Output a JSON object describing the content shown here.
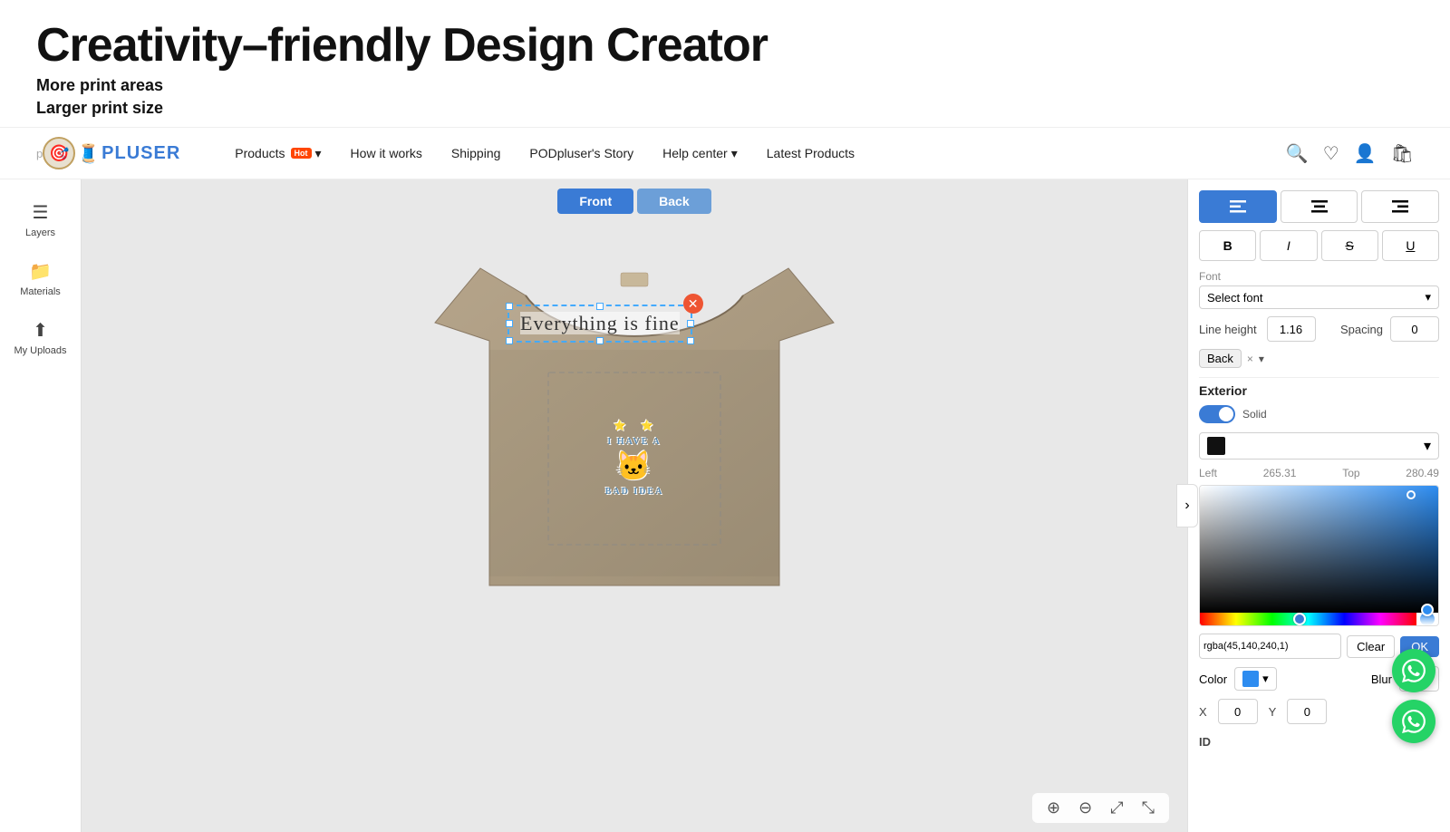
{
  "hero": {
    "title": "Creativity–friendly Design Creator",
    "sub1": "More print areas",
    "sub2": "Larger print size"
  },
  "navbar": {
    "logo_letter": "p",
    "logo_icon": "🎯",
    "logo_sewing": "🧵",
    "logo_brand": "PLUSER",
    "nav_links": [
      {
        "id": "products",
        "label": "Products",
        "has_dropdown": true,
        "has_hot": true
      },
      {
        "id": "how-it-works",
        "label": "How it works",
        "has_dropdown": false,
        "has_hot": false
      },
      {
        "id": "shipping",
        "label": "Shipping",
        "has_dropdown": false,
        "has_hot": false
      },
      {
        "id": "podplusers-story",
        "label": "PODpluser's Story",
        "has_dropdown": false,
        "has_hot": false
      },
      {
        "id": "help-center",
        "label": "Help center",
        "has_dropdown": true,
        "has_hot": false
      },
      {
        "id": "latest-products",
        "label": "Latest Products",
        "has_dropdown": false,
        "has_hot": false
      }
    ],
    "hot_badge": "Hot"
  },
  "sidebar": {
    "items": [
      {
        "id": "layers",
        "icon": "☰",
        "label": "Layers"
      },
      {
        "id": "materials",
        "icon": "📁",
        "label": "Materials"
      },
      {
        "id": "uploads",
        "icon": "⬆",
        "label": "My Uploads"
      }
    ]
  },
  "canvas": {
    "front_tab": "Front",
    "back_tab": "Back",
    "text_overlay": "Everything is fine",
    "zoom_in": "+",
    "zoom_out": "−",
    "fit": "⤢",
    "expand": "⤡"
  },
  "right_panel": {
    "align_buttons": [
      {
        "id": "align-left",
        "icon": "≡",
        "active": true
      },
      {
        "id": "align-center",
        "icon": "≡",
        "active": false
      },
      {
        "id": "align-right",
        "icon": "≡",
        "active": false
      }
    ],
    "format_buttons": [
      {
        "id": "bold",
        "label": "B"
      },
      {
        "id": "italic",
        "label": "I"
      },
      {
        "id": "strikethrough",
        "label": "S̶"
      },
      {
        "id": "underline",
        "label": "U"
      }
    ],
    "font_label": "Font",
    "line_height_label": "Line height",
    "line_height_value": "1.16",
    "spacing_label": "Spacing",
    "spacing_value": "0",
    "back_label": "Back",
    "close_x": "×",
    "exterior_label": "Exterior",
    "solid_toggle": "Solid",
    "color_swatch": "#111111",
    "left_label": "Left",
    "left_value": "265.31",
    "top_label": "Top",
    "top_value": "280.49",
    "color_picker": {
      "rgba_value": "rgba(45,140,240,1)",
      "clear_label": "Clear",
      "ok_label": "OK"
    },
    "color_label": "Color",
    "color_hex": "#2d8cf0",
    "blur_label": "Blur",
    "blur_value": "0",
    "x_label": "X",
    "x_value": "0",
    "y_label": "Y",
    "y_value": "0",
    "id_label": "ID"
  }
}
